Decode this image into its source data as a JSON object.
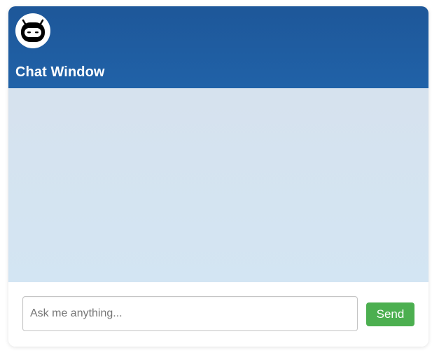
{
  "header": {
    "title": "Chat Window",
    "avatar_icon": "robot-icon",
    "gradient_top": "#1e5799",
    "gradient_bottom": "#2062a8"
  },
  "messages": {
    "items": [],
    "background": "#d4e3f1"
  },
  "composer": {
    "placeholder": "Ask me anything...",
    "value": "",
    "send_label": "Send",
    "send_color": "#4caf50"
  }
}
